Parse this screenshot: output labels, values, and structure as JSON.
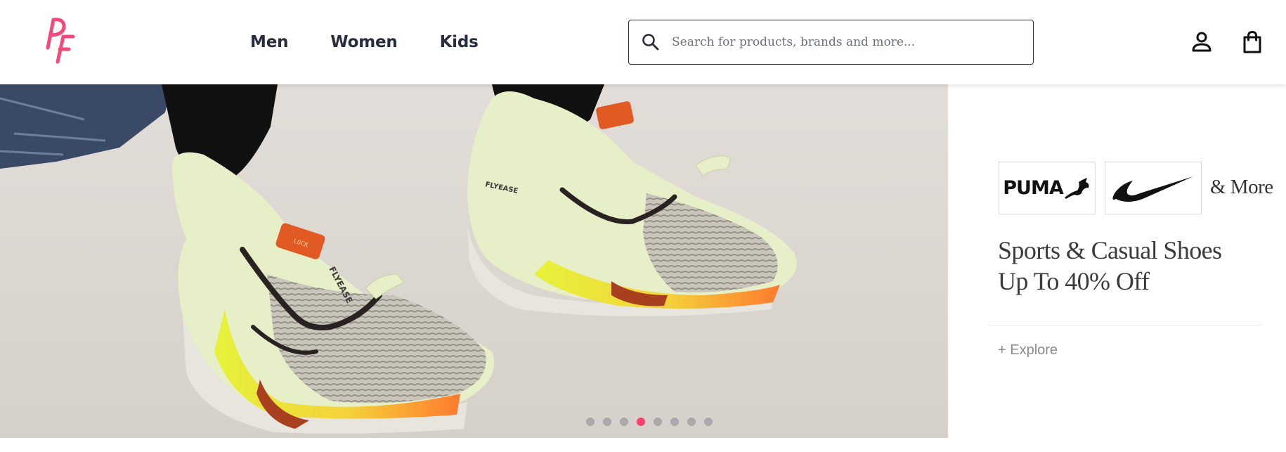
{
  "header": {
    "logo_text": "PF",
    "nav": [
      {
        "label": "Men"
      },
      {
        "label": "Women"
      },
      {
        "label": "Kids"
      }
    ],
    "search": {
      "placeholder": "Search for products, brands and more...",
      "value": ""
    }
  },
  "hero": {
    "image": "nike-running-shoes-closeup",
    "shoe_text_left": "FLYEASE",
    "shoe_text_right": "FLYEASE",
    "lock_text": "LOCK"
  },
  "promo": {
    "brands": [
      "PUMA",
      "NIKE"
    ],
    "puma_label": "PUMA",
    "and_more": "& More",
    "title": "Sports & Casual Shoes Up To 40% Off",
    "explore": "+ Explore"
  },
  "carousel": {
    "total_slides": 8,
    "active_index": 3
  },
  "colors": {
    "accent": "#ff3f6c",
    "text": "#282c3f",
    "dot_inactive": "#a9a9a9"
  }
}
